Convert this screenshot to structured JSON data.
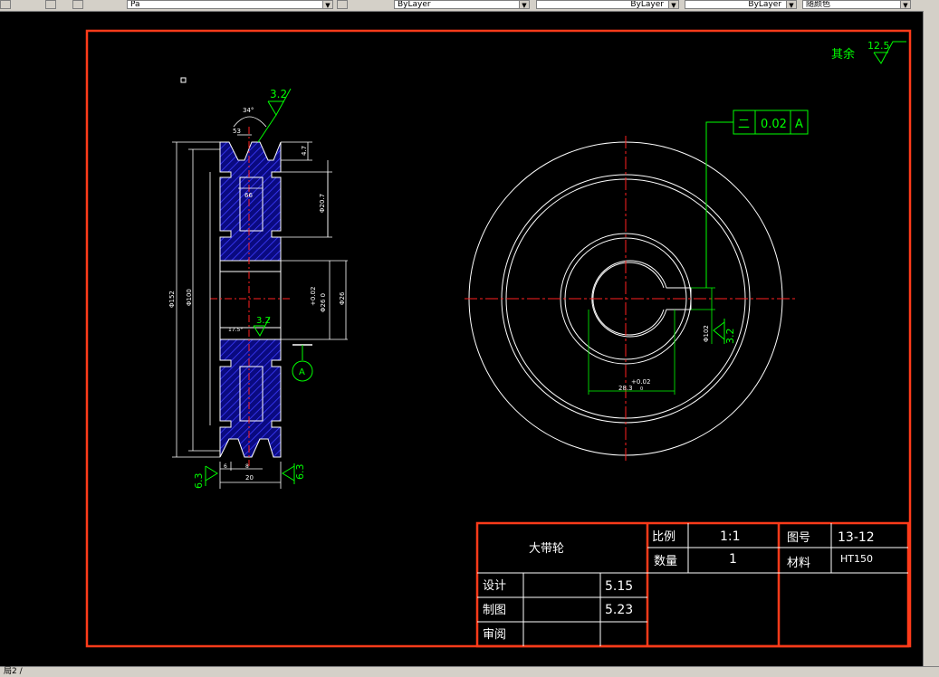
{
  "toolbar": {
    "linetype": "ByLayer",
    "lineweight": "ByLayer",
    "plotstyle": "ByLayer",
    "color": "随颜色",
    "layer_value": "Pa"
  },
  "layout_tab": "局2 /",
  "drawing": {
    "roughness_other_label": "其余",
    "roughness_other_value": "12.5",
    "section_view": {
      "roughness_top": "3.2",
      "groove_angle": "34°",
      "dim_53": "53",
      "dim_66": "66",
      "dim_phi207": "Φ20.7",
      "dim_phi152": "Φ152",
      "dim_phi100": "Φ100",
      "dim_bore_tol": "+0.02",
      "dim_bore": "Φ26 0",
      "dim_phi26": "Φ26",
      "dim_47": "4.7",
      "angle_175": "17.5°",
      "roughness_mid": "3.2",
      "datum_A": "A",
      "roughness_left": "6.3",
      "roughness_right": "6.3",
      "dim_6": "6",
      "dim_8": "8",
      "dim_20": "20"
    },
    "front_view": {
      "tolerance_symbol": "二",
      "tolerance_value": "0.02",
      "tolerance_datum": "A",
      "keyway_width_tol": "+0.02",
      "keyway_depth": "28.3",
      "keyway_tol_small": "0",
      "roughness_keyway": "3.2",
      "key_dim": "Φ102"
    },
    "title_block": {
      "part_name": "大带轮",
      "scale_label": "比例",
      "scale_value": "1:1",
      "drawing_no_label": "图号",
      "drawing_no_value": "13-12",
      "qty_label": "数量",
      "qty_value": "1",
      "material_label": "材料",
      "material_value": "HT150",
      "design_label": "设计",
      "design_date": "5.15",
      "draw_label": "制图",
      "draw_date": "5.23",
      "review_label": "审阅"
    }
  },
  "colors": {
    "border": "#ff3b1a",
    "white": "#ffffff",
    "green": "#00ff00",
    "red": "#ff2020",
    "blue_hatch": "#1a1aff",
    "background": "#000000"
  }
}
